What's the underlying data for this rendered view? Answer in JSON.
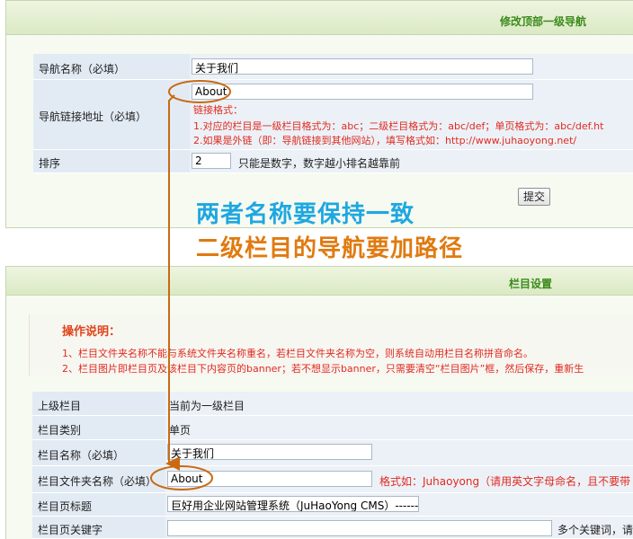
{
  "panel1": {
    "title": "修改顶部一级导航",
    "name_label": "导航名称（必填）",
    "name_value": "关于我们",
    "link_label": "导航链接地址（必填）",
    "link_value": "About",
    "link_hint_title": "链接格式：",
    "link_hint_1": "1.对应的栏目是一级栏目格式为：abc；二级栏目格式为：abc/def；单页格式为：abc/def.ht",
    "link_hint_2": "2.如果是外链（即：导航链接到其他网站），填写格式如：http://www.juhaoyong.net/",
    "sort_label": "排序",
    "sort_value": "2",
    "sort_hint": "只能是数字，数字越小排名越靠前",
    "submit_label": "提交"
  },
  "annotation": {
    "line1": "两者名称要保持一致",
    "line2": "二级栏目的导航要加路径",
    "color1": "#1ea7e1",
    "color2": "#e07a10",
    "arrow_color": "#c96a12"
  },
  "panel2": {
    "title": "栏目设置",
    "notice_title": "操作说明：",
    "notice_1": "1、栏目文件夹名称不能与系统文件夹名称重名，若栏目文件夹名称为空，则系统自动用栏目名称拼音命名。",
    "notice_2": "2、栏目图片即栏目页及该栏目下内容页的banner；若不想显示banner，只需要清空“栏目图片”框，然后保存，重新生",
    "parent_label": "上级栏目",
    "parent_value": "当前为一级栏目",
    "type_label": "栏目类别",
    "type_value": "单页",
    "name_label": "栏目名称（必填）",
    "name_value": "关于我们",
    "folder_label": "栏目文件夹名称（必填）",
    "folder_value": "About",
    "folder_hint": "格式如：Juhaoyong（请用英文字母命名，且不要带",
    "page_title_label": "栏目页标题",
    "page_title_value": "巨好用企业网站管理系统（JuHaoYong CMS）-------",
    "keywords_label": "栏目页关键字",
    "keywords_value": "",
    "keywords_hint": "多个关键词，请"
  }
}
